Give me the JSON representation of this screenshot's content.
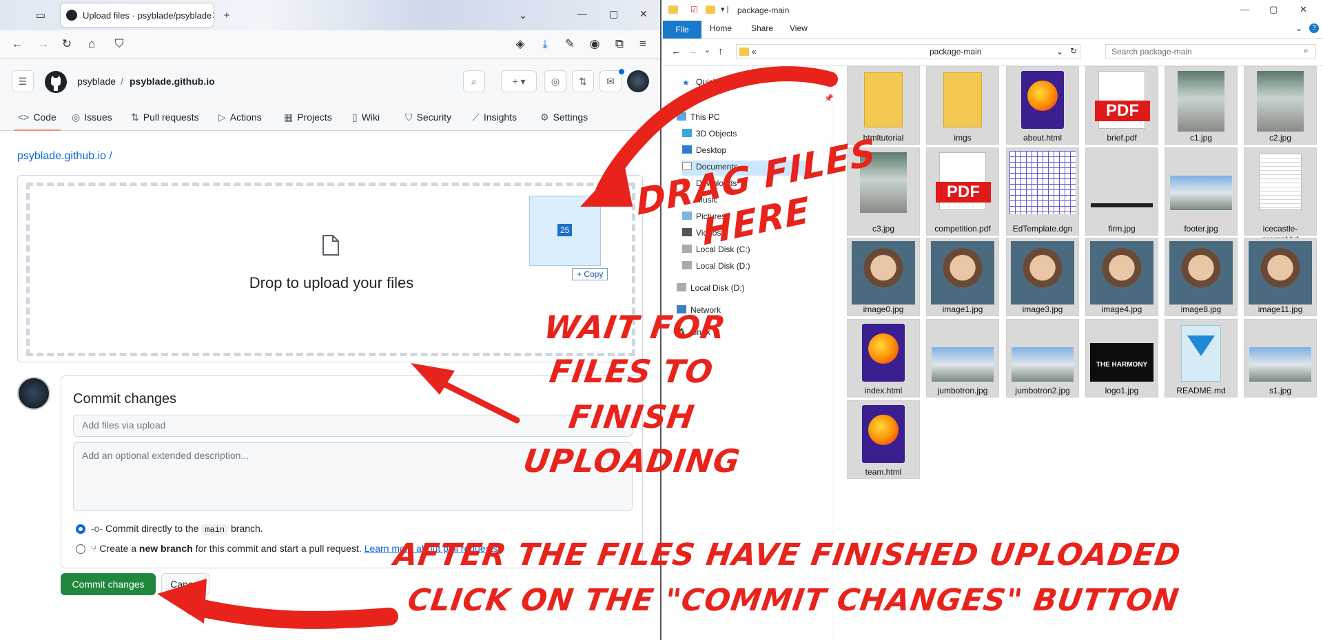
{
  "browser": {
    "tab_title": "Upload files · psyblade/psyblade",
    "repo_owner": "psyblade",
    "repo_sep": "/",
    "repo_name": "psyblade.github.io",
    "tabs": [
      {
        "label": "Code",
        "icon": "code-icon"
      },
      {
        "label": "Issues",
        "icon": "issue-icon"
      },
      {
        "label": "Pull requests",
        "icon": "pull-request-icon"
      },
      {
        "label": "Actions",
        "icon": "play-icon"
      },
      {
        "label": "Projects",
        "icon": "table-icon"
      },
      {
        "label": "Wiki",
        "icon": "book-icon"
      },
      {
        "label": "Security",
        "icon": "shield-icon"
      },
      {
        "label": "Insights",
        "icon": "graph-icon"
      },
      {
        "label": "Settings",
        "icon": "gear-icon"
      }
    ],
    "path": "psyblade.github.io /",
    "drop_text": "Drop to upload your files",
    "drag_count": "25",
    "copy_tip": "+ Copy",
    "commit_title": "Commit changes",
    "commit_placeholder": "Add files via upload",
    "description_placeholder": "Add an optional extended description...",
    "option1_pre": "Commit directly to the",
    "option1_branch": "main",
    "option1_post": "branch.",
    "option2_pre": "Create a",
    "option2_bold": "new branch",
    "option2_post": "for this commit and start a pull request.",
    "option2_link": "Learn more about pull requests",
    "commit_button": "Commit changes",
    "cancel_button": "Cancel"
  },
  "explorer": {
    "window_title": "package-main",
    "ribbon": [
      "File",
      "Home",
      "Share",
      "View"
    ],
    "address_prefix": "«",
    "address": "package-main",
    "search_placeholder": "Search package-main",
    "nav": [
      {
        "label": "Quick access",
        "icon": "star-icon"
      },
      {
        "label": "This PC",
        "icon": "pc-icon"
      },
      {
        "label": "3D Objects",
        "icon": "cube-icon"
      },
      {
        "label": "Desktop",
        "icon": "desktop-icon"
      },
      {
        "label": "Documents",
        "icon": "documents-icon"
      },
      {
        "label": "Downloads",
        "icon": "download-icon"
      },
      {
        "label": "Music",
        "icon": "music-icon"
      },
      {
        "label": "Pictures",
        "icon": "pictures-icon"
      },
      {
        "label": "Videos",
        "icon": "video-icon"
      },
      {
        "label": "Local Disk (C:)",
        "icon": "drive-icon"
      },
      {
        "label": "Local Disk (D:)",
        "icon": "drive-icon"
      },
      {
        "label": "Local Disk (D:)",
        "icon": "drive-icon"
      },
      {
        "label": "Network",
        "icon": "network-icon"
      },
      {
        "label": "Linux",
        "icon": "linux-icon"
      }
    ],
    "files": [
      {
        "name": "htmltutorial",
        "kind": "folder"
      },
      {
        "name": "imgs",
        "kind": "folder"
      },
      {
        "name": "about.html",
        "kind": "firefox"
      },
      {
        "name": "brief.pdf",
        "kind": "pdf"
      },
      {
        "name": "c1.jpg",
        "kind": "photo"
      },
      {
        "name": "c2.jpg",
        "kind": "photo"
      },
      {
        "name": "c3.jpg",
        "kind": "photo"
      },
      {
        "name": "competition.pdf",
        "kind": "pdf"
      },
      {
        "name": "EdTemplate.dgn",
        "kind": "grid"
      },
      {
        "name": "firm.jpg",
        "kind": "strip"
      },
      {
        "name": "footer.jpg",
        "kind": "landscape"
      },
      {
        "name": "icecastle-prompt.txt",
        "kind": "text"
      },
      {
        "name": "image0.jpg",
        "kind": "portrait"
      },
      {
        "name": "image1.jpg",
        "kind": "portrait"
      },
      {
        "name": "image3.jpg",
        "kind": "portrait"
      },
      {
        "name": "image4.jpg",
        "kind": "portrait"
      },
      {
        "name": "image8.jpg",
        "kind": "portrait"
      },
      {
        "name": "image11.jpg",
        "kind": "portrait"
      },
      {
        "name": "index.html",
        "kind": "firefox"
      },
      {
        "name": "jumbotron.jpg",
        "kind": "landscape"
      },
      {
        "name": "jumbotron2.jpg",
        "kind": "landscape"
      },
      {
        "name": "logo1.jpg",
        "kind": "logo"
      },
      {
        "name": "README.md",
        "kind": "vscode"
      },
      {
        "name": "s1.jpg",
        "kind": "landscape"
      },
      {
        "name": "team.html",
        "kind": "firefox"
      }
    ],
    "logo_text": "THE HARMONY"
  },
  "annotations": {
    "drag_line1": "DRAG FILES",
    "drag_line2": "HERE",
    "wait_lines": [
      "WAIT FOR",
      "FILES TO",
      "FINISH",
      "UPLOADING"
    ],
    "after_line1": "AFTER THE FILES HAVE FINISHED UPLOADED",
    "after_line2": "CLICK ON THE \"COMMIT CHANGES\" BUTTON"
  }
}
